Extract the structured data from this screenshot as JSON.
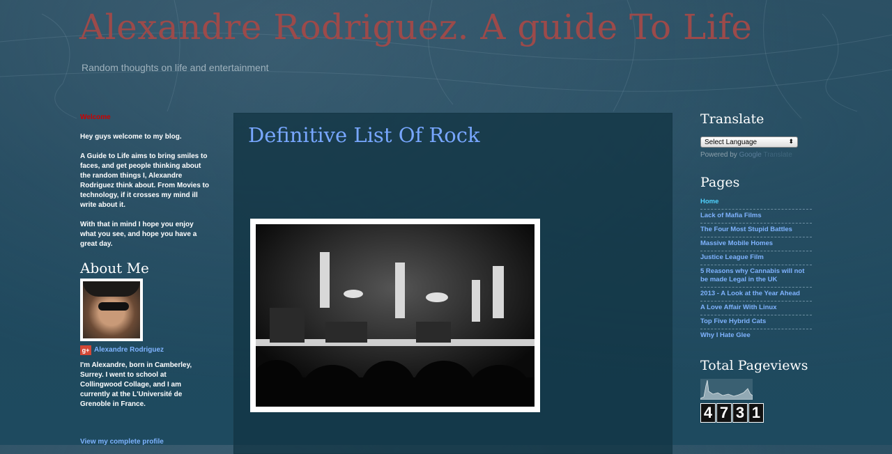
{
  "header": {
    "title": "Alexandre Rodriguez. A guide To Life",
    "description": "Random thoughts on life and entertainment"
  },
  "left_sidebar": {
    "welcome_title": "Welcome",
    "welcome_paragraphs": [
      "Hey guys welcome to my blog.",
      "A Guide to Life aims to bring smiles to faces, and get people thinking about the random things I, Alexandre Rodriguez think about. From Movies to technology, if it crosses my mind ill write about it.",
      "With that in mind I hope you enjoy what you see, and hope you have a great day."
    ],
    "about_title": "About Me",
    "profile_name": "Alexandre Rodriguez",
    "gplus_icon": "google-plus-icon",
    "bio": "I'm Alexandre, born in Camberley, Surrey. I went to school at Collingwood Collage, and I am currently at the L'Université de Grenoble in France.",
    "view_profile": "View my complete profile"
  },
  "post": {
    "title": "Definitive List Of Rock"
  },
  "right_sidebar": {
    "translate_title": "Translate",
    "select_label": "Select Language",
    "powered_by": "Powered by",
    "google_word": "Google",
    "translate_word": "Translate",
    "pages_title": "Pages",
    "pages": [
      {
        "label": "Home",
        "active": true
      },
      {
        "label": "Lack of Mafia Films",
        "active": false
      },
      {
        "label": "The Four Most Stupid Battles",
        "active": false
      },
      {
        "label": "Massive Mobile Homes",
        "active": false
      },
      {
        "label": "Justice League Film",
        "active": false
      },
      {
        "label": "5 Reasons why Cannabis will not be made Legal in the UK",
        "active": false
      },
      {
        "label": "2013 - A Look at the Year Ahead",
        "active": false
      },
      {
        "label": "A Love Affair With Linux",
        "active": false
      },
      {
        "label": "Top Five Hybrid Cats",
        "active": false
      },
      {
        "label": "Why I Hate Glee",
        "active": false
      }
    ],
    "pageviews_title": "Total Pageviews",
    "pageviews_digits": [
      "4",
      "7",
      "3",
      "1"
    ]
  },
  "colors": {
    "background": "#254e62",
    "title_red": "#9c4a4a",
    "link_blue": "#7fb3ff",
    "post_title": "#78a7ff"
  }
}
